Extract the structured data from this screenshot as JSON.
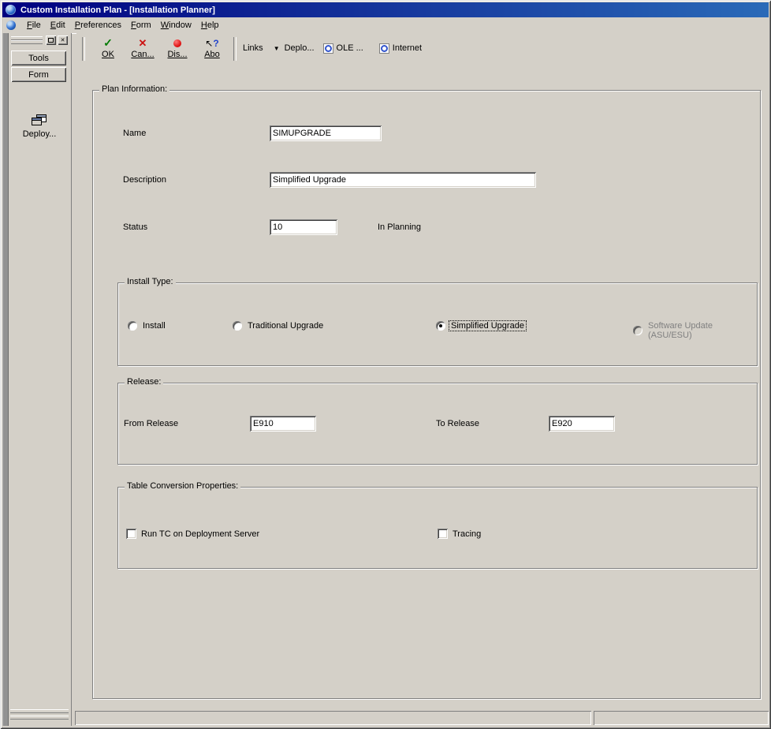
{
  "window": {
    "title": "Custom Installation Plan - [Installation Planner]"
  },
  "menu": {
    "items": [
      {
        "label": "File"
      },
      {
        "label": "Edit"
      },
      {
        "label": "Preferences"
      },
      {
        "label": "Form"
      },
      {
        "label": "Window"
      },
      {
        "label": "Help"
      }
    ]
  },
  "toolbar": {
    "ok_label": "OK",
    "cancel_label": "Can...",
    "display_label": "Dis...",
    "about_label": "Abo",
    "links_label": "Links",
    "deploy_label": "Deplo...",
    "ole_label": "OLE ...",
    "internet_label": "Internet"
  },
  "sidebar": {
    "tools_tab": "Tools",
    "form_tab": "Form",
    "deploy_item": "Deploy..."
  },
  "form": {
    "plan_info": {
      "legend": "Plan Information:",
      "name_label": "Name",
      "name_value": "SIMUPGRADE",
      "description_label": "Description",
      "description_value": "Simplified Upgrade",
      "status_label": "Status",
      "status_value": "10",
      "status_text": "In Planning"
    },
    "install_type": {
      "legend": "Install Type:",
      "options": [
        {
          "label": "Install",
          "selected": false,
          "disabled": false,
          "focused": false
        },
        {
          "label": "Traditional Upgrade",
          "selected": false,
          "disabled": false,
          "focused": false
        },
        {
          "label": "Simplified Upgrade",
          "selected": true,
          "disabled": false,
          "focused": true
        },
        {
          "label": "Software Update (ASU/ESU)",
          "selected": false,
          "disabled": true,
          "focused": false
        }
      ]
    },
    "release": {
      "legend": "Release:",
      "from_label": "From Release",
      "from_value": "E910",
      "to_label": "To Release",
      "to_value": "E920"
    },
    "tc_properties": {
      "legend": "Table Conversion Properties:",
      "checkboxes": [
        {
          "label": "Run TC on Deployment Server",
          "checked": false
        },
        {
          "label": "Tracing",
          "checked": false
        }
      ]
    }
  },
  "colors": {
    "titlebar_start": "#000080",
    "titlebar_end": "#2a6ab8",
    "ok_green": "#007a00",
    "cancel_red": "#cc1111",
    "record_red": "#dd1111",
    "background": "#d4d0c8",
    "disabled_text": "#808080",
    "help_blue": "#2244cc"
  }
}
